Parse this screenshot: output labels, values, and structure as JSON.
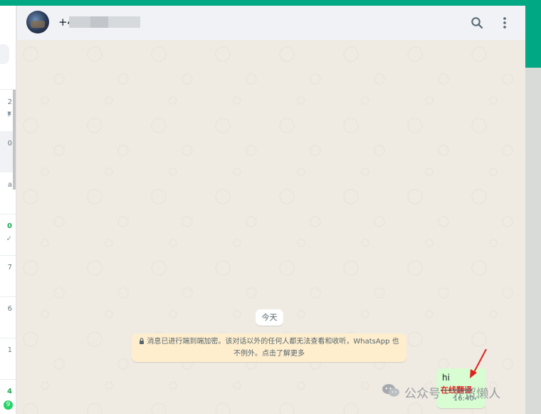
{
  "header": {
    "contact_name": "+4          000"
  },
  "sidebar": {
    "rows": [
      {
        "time": "2",
        "meta": "✓"
      },
      {
        "time": "0",
        "meta": ""
      },
      {
        "time": "a",
        "meta": ""
      },
      {
        "time": "0",
        "meta": "✓"
      },
      {
        "time": "7",
        "meta": ""
      },
      {
        "time": "6",
        "meta": ""
      },
      {
        "time": "1",
        "meta": ""
      },
      {
        "time": "4",
        "meta": "",
        "unread": "9"
      }
    ]
  },
  "conversation": {
    "date_chip": "今天",
    "encryption_notice": "消息已进行端到端加密。该对话以外的任何人都无法查看和收听，WhatsApp 也不例外。点击了解更多",
    "messages": [
      {
        "text": "hi",
        "translate_label": "在线翻译",
        "time": "16:40",
        "status": "✓"
      }
    ]
  },
  "watermark": {
    "text": "公众号 · 外贸懒人"
  },
  "colors": {
    "accent": "#00a884",
    "outgoing_bubble": "#d9fdd3",
    "notice_bg": "#ffeecd",
    "annotation": "#e02020"
  }
}
